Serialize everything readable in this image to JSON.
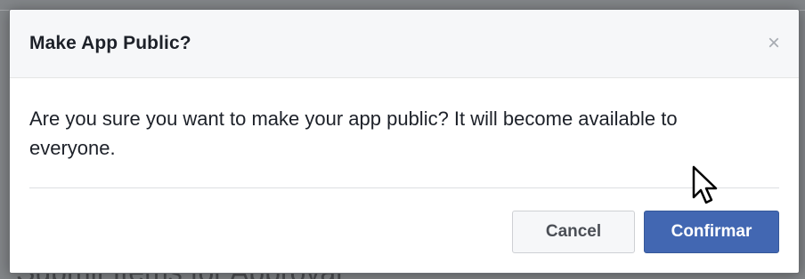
{
  "dialog": {
    "title": "Make App Public?",
    "close_glyph": "×",
    "message": "Are you sure you want to make your app public? It will become available to everyone.",
    "cancel_label": "Cancel",
    "confirm_label": "Confirmar"
  },
  "background_page": {
    "partial_heading": "Submit Items for Approval"
  },
  "colors": {
    "primary_button": "#4267b2",
    "header_bg": "#f6f7f9"
  },
  "icons": {
    "close": "close-icon",
    "pointer": "cursor-icon"
  }
}
